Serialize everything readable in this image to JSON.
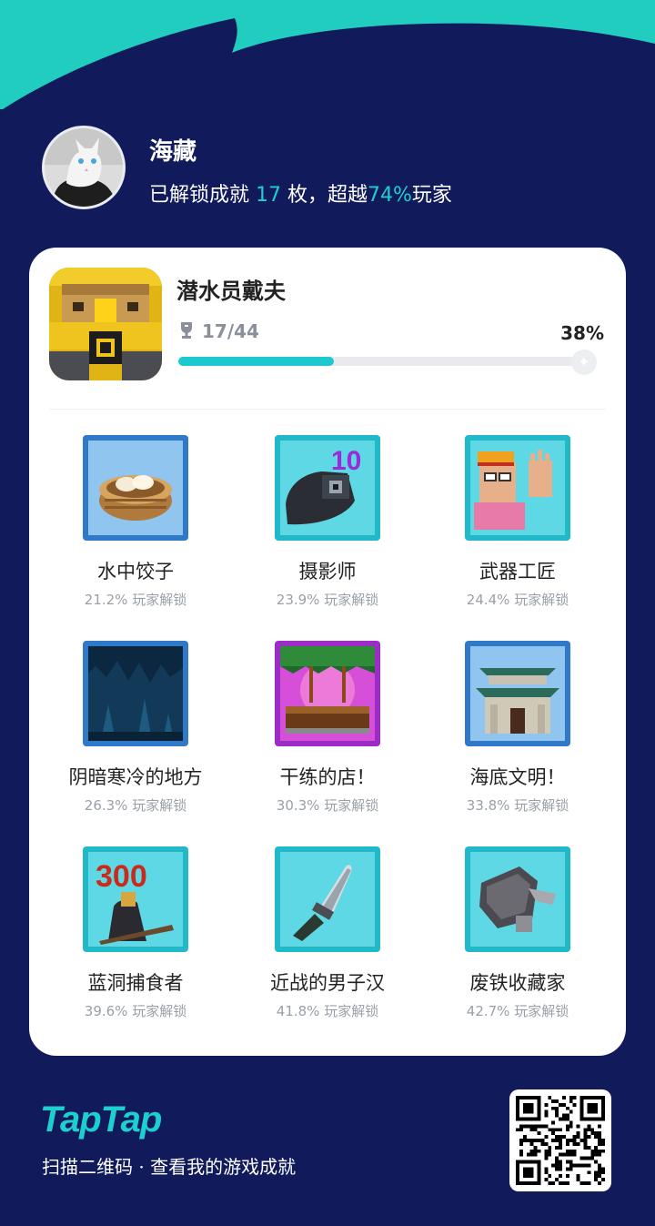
{
  "theme": {
    "background": "#111a5a",
    "accent": "#1ecfd0"
  },
  "profile": {
    "name": "海藏",
    "stat_prefix": "已解锁成就 ",
    "stat_count": "17",
    "stat_mid": " 枚，超越",
    "stat_percent": "74%",
    "stat_suffix": "玩家",
    "avatar_icon": "white-cat-avatar"
  },
  "game": {
    "title": "潜水员戴夫",
    "trophy_icon": "trophy-icon",
    "progress_text": "17/44",
    "percent_text": "38%",
    "progress_fraction": 0.38
  },
  "achievements": [
    {
      "name": "水中饺子",
      "percent": "21.2% 玩家解锁",
      "icon": "dumpling-steamer-icon"
    },
    {
      "name": "摄影师",
      "percent": "23.9% 玩家解锁",
      "icon": "camera-10-icon"
    },
    {
      "name": "武器工匠",
      "percent": "24.4% 玩家解锁",
      "icon": "craftsman-waving-icon"
    },
    {
      "name": "阴暗寒冷的地方",
      "percent": "26.3% 玩家解锁",
      "icon": "dark-cave-icon"
    },
    {
      "name": "干练的店！",
      "percent": "30.3% 玩家解锁",
      "icon": "shop-stall-icon"
    },
    {
      "name": "海底文明！",
      "percent": "33.8% 玩家解锁",
      "icon": "undersea-temple-icon"
    },
    {
      "name": "蓝洞捕食者",
      "percent": "39.6% 玩家解锁",
      "icon": "hunter-300-icon"
    },
    {
      "name": "近战的男子汉",
      "percent": "41.8% 玩家解锁",
      "icon": "knife-icon"
    },
    {
      "name": "废铁收藏家",
      "percent": "42.7% 玩家解锁",
      "icon": "scrap-metal-icon"
    }
  ],
  "footer": {
    "logo": "TapTap",
    "slogan": "扫描二维码 · 查看我的游戏成就",
    "qr_icon": "qr-code-icon"
  },
  "icon_texts": {
    "camera_badge": "10",
    "hunter_badge": "300"
  }
}
